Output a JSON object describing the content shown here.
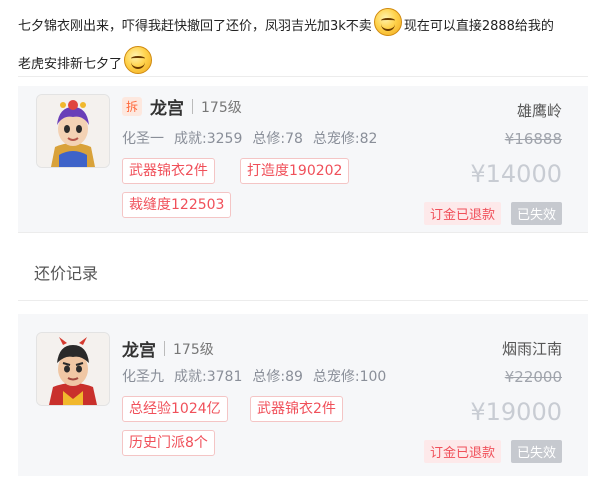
{
  "post": {
    "line1_a": "七夕锦衣刚出来，吓得我赶快撤回了还价，凤羽吉光加3k不卖",
    "line1_b": "现在可以直接2888给我的",
    "line2": "老虎安排新七夕了",
    "emoji_icon": "smile-emoji"
  },
  "history_label": "还价记录",
  "listings": [
    {
      "chai_badge": "拆",
      "name": "龙宫",
      "level": "175级",
      "stats": [
        "化圣一",
        "成就:3259",
        "总修:78",
        "总宠修:82"
      ],
      "tags": [
        "武器锦衣2件",
        "打造度190202",
        "裁缝度122503"
      ],
      "server": "雄鹰岭",
      "original_price": "¥16888",
      "price": "¥14000",
      "refund_label": "订金已退款",
      "status_label": "已失效"
    },
    {
      "name": "龙宫",
      "level": "175级",
      "stats": [
        "化圣九",
        "成就:3781",
        "总修:89",
        "总宠修:100"
      ],
      "tags": [
        "总经验1024亿",
        "武器锦衣2件",
        "历史门派8个"
      ],
      "server": "烟雨江南",
      "original_price": "¥22000",
      "price": "¥19000",
      "refund_label": "订金已退款",
      "status_label": "已失效"
    }
  ]
}
